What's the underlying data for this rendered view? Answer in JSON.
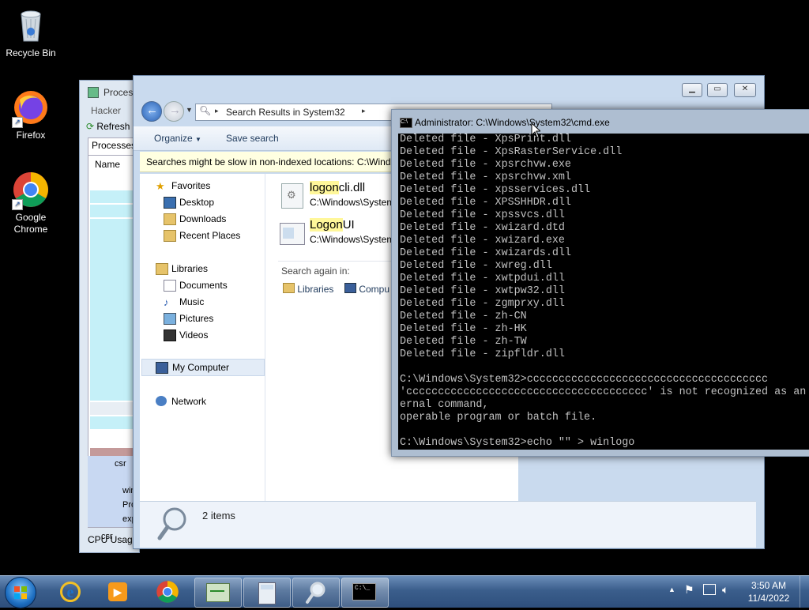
{
  "desktop": {
    "icons": [
      {
        "label": "Recycle Bin",
        "icon": "recycle-bin-icon"
      },
      {
        "label": "Firefox",
        "icon": "firefox-icon"
      },
      {
        "label": "Google\nChrome",
        "icon": "chrome-icon"
      }
    ]
  },
  "process_hacker": {
    "title": "Process",
    "menu_hacker": "Hacker",
    "refresh": "Refresh",
    "tab_processes": "Processes",
    "col_name": "Name",
    "rows": [
      "csr",
      "win",
      "Pro",
      "exp"
    ],
    "status": "CPU Usage"
  },
  "explorer": {
    "address": "Search Results in System32",
    "toolbar": {
      "organize": "Organize",
      "save_search": "Save search"
    },
    "infobar": "Searches might be slow in non-indexed locations: C:\\Windows",
    "nav": {
      "favorites": "Favorites",
      "desktop": "Desktop",
      "downloads": "Downloads",
      "recent": "Recent Places",
      "libraries": "Libraries",
      "documents": "Documents",
      "music": "Music",
      "pictures": "Pictures",
      "videos": "Videos",
      "computer": "My Computer",
      "network": "Network"
    },
    "results": [
      {
        "hl": "logon",
        "rest": "cli.dll",
        "path": "C:\\Windows\\System"
      },
      {
        "hl": "Logon",
        "rest": "UI",
        "path": "C:\\Windows\\System"
      }
    ],
    "search_again": "Search again in:",
    "search_libraries": "Libraries",
    "search_computer": "Compu",
    "item_count": "2 items"
  },
  "cmd": {
    "title": "Administrator:  C:\\Windows\\System32\\cmd.exe",
    "lines": [
      "Deleted file - XpsPrint.dll",
      "Deleted file - XpsRasterService.dll",
      "Deleted file - xpsrchvw.exe",
      "Deleted file - xpsrchvw.xml",
      "Deleted file - xpsservices.dll",
      "Deleted file - XPSSHHDR.dll",
      "Deleted file - xpssvcs.dll",
      "Deleted file - xwizard.dtd",
      "Deleted file - xwizard.exe",
      "Deleted file - xwizards.dll",
      "Deleted file - xwreg.dll",
      "Deleted file - xwtpdui.dll",
      "Deleted file - xwtpw32.dll",
      "Deleted file - zgmprxy.dll",
      "Deleted file - zh-CN",
      "Deleted file - zh-HK",
      "Deleted file - zh-TW",
      "Deleted file - zipfldr.dll",
      "",
      "C:\\Windows\\System32>cccccccccccccccccccccccccccccccccccccc",
      "'cccccccccccccccccccccccccccccccccccccc' is not recognized as an int",
      "ernal command,",
      "operable program or batch file.",
      "",
      "C:\\Windows\\System32>echo \"\" > winlogo"
    ]
  },
  "taskbar": {
    "items": [
      "start-orb",
      "ie-icon",
      "media-player-icon",
      "chrome-icon",
      "process-hacker-icon",
      "calculator-icon",
      "search-icon",
      "cmd-icon"
    ],
    "time": "3:50 AM",
    "date": "11/4/2022"
  }
}
